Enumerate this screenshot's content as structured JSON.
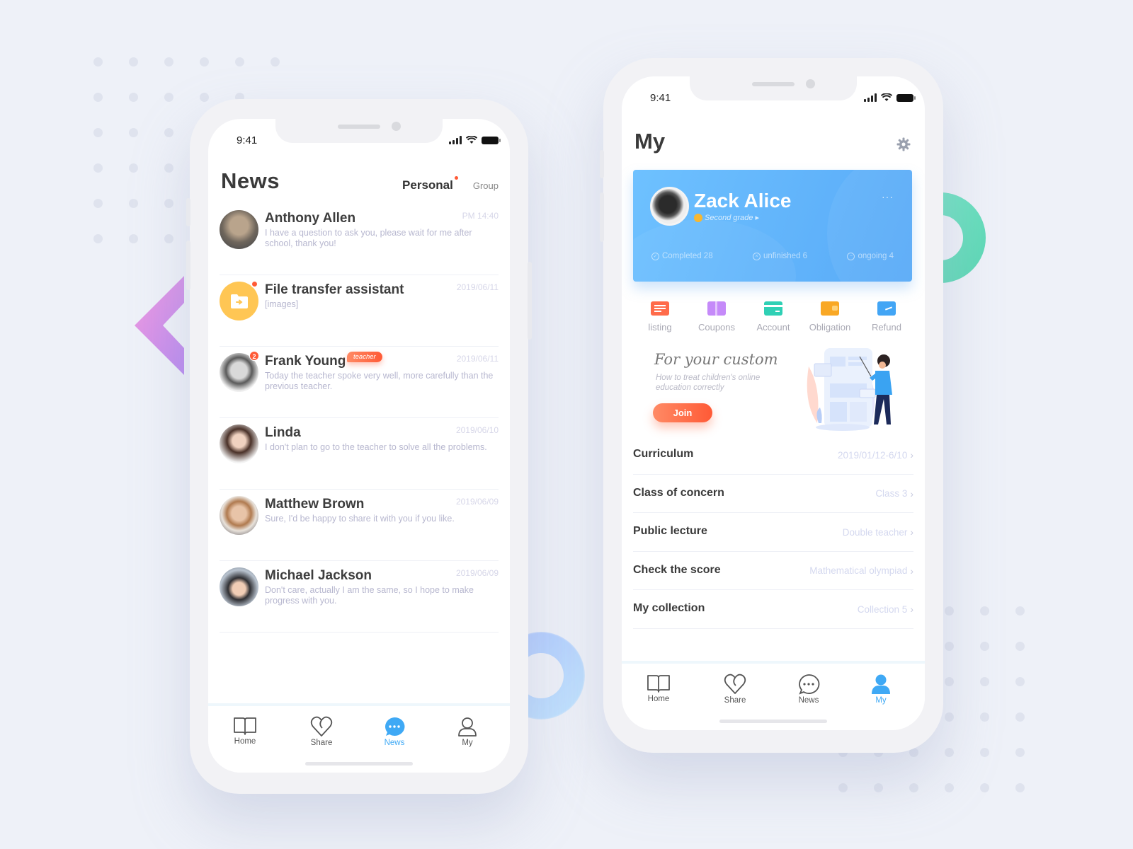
{
  "news_screen": {
    "status_time": "9:41",
    "title": "News",
    "tabs": {
      "personal": "Personal",
      "group": "Group"
    },
    "messages": [
      {
        "name": "Anthony Allen",
        "time": "PM 14:40",
        "text": "I have a question to ask you, please wait for me after school, thank you!",
        "badge": "",
        "tag": ""
      },
      {
        "name": "File transfer assistant",
        "time": "2019/06/11",
        "text": "[images]",
        "badge": "dot",
        "tag": ""
      },
      {
        "name": "Frank Young",
        "time": "2019/06/11",
        "text": "Today the teacher spoke very well, more carefully than the previous teacher.",
        "badge": "2",
        "tag": "teacher"
      },
      {
        "name": "Linda",
        "time": "2019/06/10",
        "text": "I don't plan to go to the teacher to solve all the problems.",
        "badge": "",
        "tag": ""
      },
      {
        "name": "Matthew Brown",
        "time": "2019/06/09",
        "text": "Sure, I'd be happy to share it with you if you like.",
        "badge": "",
        "tag": ""
      },
      {
        "name": "Michael Jackson",
        "time": "2019/06/09",
        "text": "Don't care, actually I am the same, so I hope to make progress with you.",
        "badge": "",
        "tag": ""
      }
    ],
    "tabbar": [
      {
        "label": "Home",
        "icon": "book-icon",
        "active": false
      },
      {
        "label": "Share",
        "icon": "heart-icon",
        "active": false
      },
      {
        "label": "News",
        "icon": "chat-bubble-icon",
        "active": true
      },
      {
        "label": "My",
        "icon": "user-icon",
        "active": false
      }
    ]
  },
  "my_screen": {
    "status_time": "9:41",
    "title": "My",
    "profile": {
      "name": "Zack Alice",
      "grade": "Second grade",
      "grade_arrow": "▸",
      "more": "···",
      "stats": [
        {
          "icon": "check-circle-icon",
          "glyph": "✓",
          "label": "Completed 28"
        },
        {
          "icon": "x-circle-icon",
          "glyph": "×",
          "label": "unfinished 6"
        },
        {
          "icon": "minus-circle-icon",
          "glyph": "−",
          "label": "ongoing 4"
        }
      ]
    },
    "quick_actions": [
      {
        "label": "listing",
        "icon": "list-icon",
        "color": "#ff6b4a"
      },
      {
        "label": "Coupons",
        "icon": "coupon-icon",
        "color": "#c58af9"
      },
      {
        "label": "Account",
        "icon": "card-icon",
        "color": "#2fd0b5"
      },
      {
        "label": "Obligation",
        "icon": "wallet-icon",
        "color": "#f9a825"
      },
      {
        "label": "Refund",
        "icon": "refund-icon",
        "color": "#42a5f5"
      }
    ],
    "promo": {
      "title": "For your custom",
      "subtitle": "How to treat children's online education correctly",
      "button": "Join"
    },
    "menu": [
      {
        "label": "Curriculum",
        "value": "2019/01/12-6/10"
      },
      {
        "label": "Class of concern",
        "value": "Class 3"
      },
      {
        "label": "Public lecture",
        "value": "Double teacher"
      },
      {
        "label": "Check the score",
        "value": "Mathematical olympiad"
      },
      {
        "label": "My collection",
        "value": "Collection 5"
      }
    ],
    "chevron": "›",
    "tabbar": [
      {
        "label": "Home",
        "icon": "book-icon",
        "active": false
      },
      {
        "label": "Share",
        "icon": "heart-icon",
        "active": false
      },
      {
        "label": "News",
        "icon": "chat-bubble-icon",
        "active": false
      },
      {
        "label": "My",
        "icon": "user-icon",
        "active": true
      }
    ]
  },
  "colors": {
    "accent_blue": "#3fa9f5",
    "accent_orange": "#ff5a36",
    "card_blue": "#5eb2fa"
  }
}
